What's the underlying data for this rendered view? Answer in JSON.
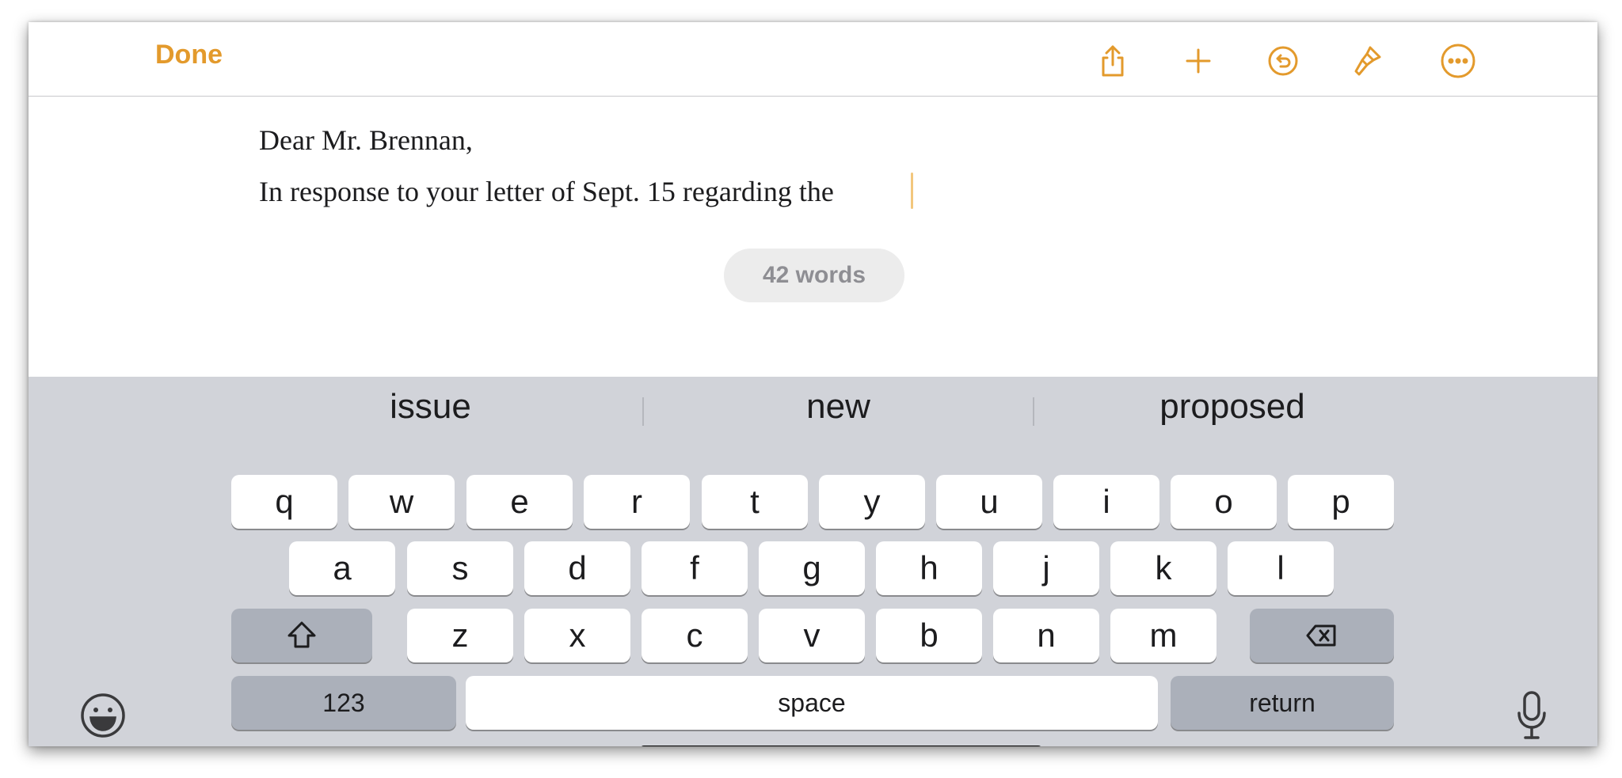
{
  "toolbar": {
    "done_label": "Done",
    "icons": [
      "share-icon",
      "plus-icon",
      "undo-icon",
      "paintbrush-icon",
      "more-icon"
    ],
    "accent_color": "#e39a2c"
  },
  "document": {
    "salutation": "Dear Mr. Brennan,",
    "body_line": "In response to your letter of Sept. 15 regarding the",
    "word_count": "42 words"
  },
  "keyboard": {
    "suggestions": [
      "issue",
      "new",
      "proposed"
    ],
    "row1": [
      "q",
      "w",
      "e",
      "r",
      "t",
      "y",
      "u",
      "i",
      "o",
      "p"
    ],
    "row2": [
      "a",
      "s",
      "d",
      "f",
      "g",
      "h",
      "j",
      "k",
      "l"
    ],
    "row3": [
      "z",
      "x",
      "c",
      "v",
      "b",
      "n",
      "m"
    ],
    "numbers_label": "123",
    "space_label": "space",
    "return_label": "return",
    "icons": [
      "shift-icon",
      "delete-icon",
      "emoji-icon",
      "microphone-icon"
    ]
  }
}
